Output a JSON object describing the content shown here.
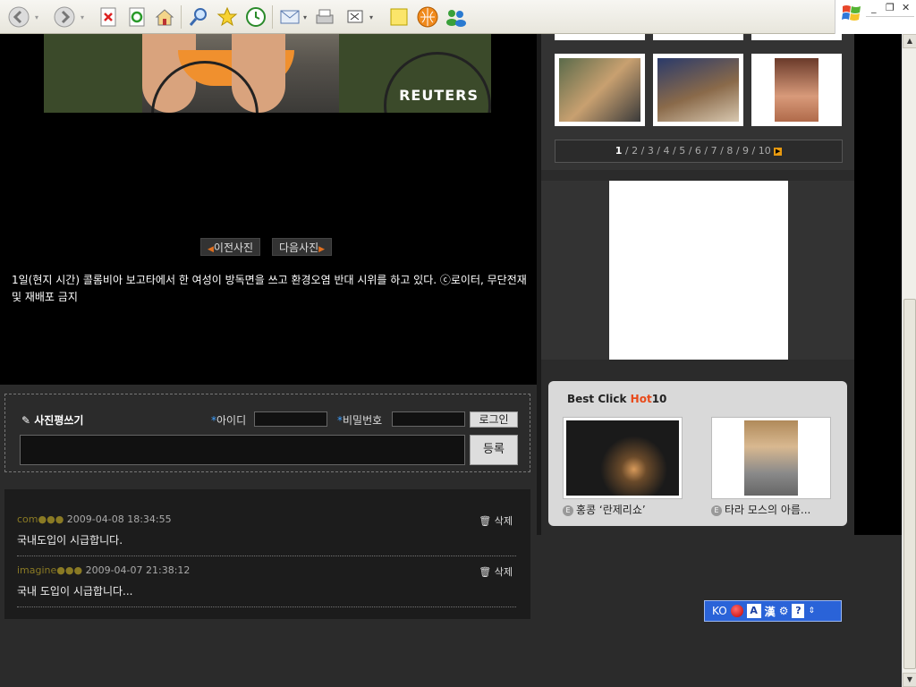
{
  "browser": {
    "toolbar_icons": [
      "back-icon",
      "forward-icon",
      "stop-icon",
      "refresh-icon",
      "home-icon",
      "search-icon",
      "favorites-icon",
      "history-icon",
      "mail-icon",
      "print-icon",
      "edit-icon",
      "notes-icon",
      "messenger-icon",
      "msn-icon"
    ]
  },
  "photo": {
    "watermark": "REUTERS"
  },
  "nav": {
    "prev": "이전사진",
    "next": "다음사진"
  },
  "caption": "1일(현지 시간) 콜롬비아 보고타에서 한 여성이 방독면을 쓰고 환경오염 반대 시위를 하고 있다. ⓒ로이터, 무단전재 및 재배포 금지",
  "comment_form": {
    "title": "사진평쓰기",
    "id_label": "아이디",
    "pw_label": "비밀번호",
    "login_button": "로그인",
    "submit_button": "등록"
  },
  "comments": [
    {
      "author": "com●●●",
      "date": "2009-04-08 18:34:55",
      "text": "국내도입이 시급합니다.",
      "delete": "삭제"
    },
    {
      "author": "imagine●●●",
      "date": "2009-04-07 21:38:12",
      "text": "국내 도입이 시급합니다...",
      "delete": "삭제"
    }
  ],
  "pager": {
    "current": "1",
    "pages": [
      "2",
      "3",
      "4",
      "5",
      "6",
      "7",
      "8",
      "9",
      "10"
    ]
  },
  "hot": {
    "title_prefix": "Best Click ",
    "title_accent": "Hot",
    "title_suffix": "10",
    "items": [
      {
        "caption": "홍콩 ‘란제리쇼’"
      },
      {
        "caption": "타라 모스의 아름..."
      }
    ]
  },
  "ime": {
    "lang": "KO",
    "a": "A",
    "han": "漢"
  }
}
